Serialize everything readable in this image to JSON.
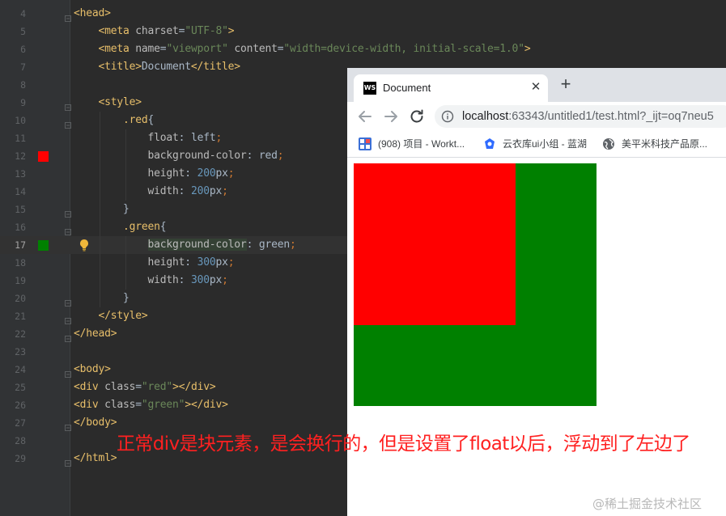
{
  "editor": {
    "lines": [
      {
        "n": "4",
        "parts": [
          [
            "tag",
            "<head>"
          ]
        ]
      },
      {
        "n": "5",
        "parts": [
          [
            "text",
            "    "
          ],
          [
            "tag",
            "<meta "
          ],
          [
            "attr",
            "charset"
          ],
          [
            "text",
            "="
          ],
          [
            "str",
            "\"UTF-8\""
          ],
          [
            "tag",
            ">"
          ]
        ]
      },
      {
        "n": "6",
        "parts": [
          [
            "text",
            "    "
          ],
          [
            "tag",
            "<meta "
          ],
          [
            "attr",
            "name"
          ],
          [
            "text",
            "="
          ],
          [
            "str",
            "\"viewport\" "
          ],
          [
            "attr",
            "content"
          ],
          [
            "text",
            "="
          ],
          [
            "str",
            "\"width=device-width, initial-scale=1.0\""
          ],
          [
            "tag",
            ">"
          ]
        ]
      },
      {
        "n": "7",
        "parts": [
          [
            "text",
            "    "
          ],
          [
            "tag",
            "<title>"
          ],
          [
            "text",
            "Document"
          ],
          [
            "tag",
            "</title>"
          ]
        ]
      },
      {
        "n": "8",
        "parts": []
      },
      {
        "n": "9",
        "parts": [
          [
            "text",
            "    "
          ],
          [
            "tag",
            "<style>"
          ]
        ]
      },
      {
        "n": "10",
        "parts": [
          [
            "text",
            "        "
          ],
          [
            "sel",
            ".red"
          ],
          [
            "text",
            "{"
          ]
        ]
      },
      {
        "n": "11",
        "parts": [
          [
            "text",
            "            "
          ],
          [
            "prop",
            "float"
          ],
          [
            "text",
            ": "
          ],
          [
            "val",
            "left"
          ],
          [
            "punc",
            ";"
          ]
        ]
      },
      {
        "n": "12",
        "parts": [
          [
            "text",
            "            "
          ],
          [
            "prop",
            "background-color"
          ],
          [
            "text",
            ": "
          ],
          [
            "val",
            "red"
          ],
          [
            "punc",
            ";"
          ]
        ]
      },
      {
        "n": "13",
        "parts": [
          [
            "text",
            "            "
          ],
          [
            "prop",
            "height"
          ],
          [
            "text",
            ": "
          ],
          [
            "num",
            "200"
          ],
          [
            "val",
            "px"
          ],
          [
            "punc",
            ";"
          ]
        ]
      },
      {
        "n": "14",
        "parts": [
          [
            "text",
            "            "
          ],
          [
            "prop",
            "width"
          ],
          [
            "text",
            ": "
          ],
          [
            "num",
            "200"
          ],
          [
            "val",
            "px"
          ],
          [
            "punc",
            ";"
          ]
        ]
      },
      {
        "n": "15",
        "parts": [
          [
            "text",
            "        }"
          ]
        ]
      },
      {
        "n": "16",
        "parts": [
          [
            "text",
            "        "
          ],
          [
            "sel",
            ".green"
          ],
          [
            "text",
            "{"
          ]
        ]
      },
      {
        "n": "17",
        "parts": [
          [
            "text",
            "            "
          ],
          [
            "prop",
            "background-color"
          ],
          [
            "text",
            ": "
          ],
          [
            "val",
            "green"
          ],
          [
            "punc",
            ";"
          ]
        ]
      },
      {
        "n": "18",
        "parts": [
          [
            "text",
            "            "
          ],
          [
            "prop",
            "height"
          ],
          [
            "text",
            ": "
          ],
          [
            "num",
            "300"
          ],
          [
            "val",
            "px"
          ],
          [
            "punc",
            ";"
          ]
        ]
      },
      {
        "n": "19",
        "parts": [
          [
            "text",
            "            "
          ],
          [
            "prop",
            "width"
          ],
          [
            "text",
            ": "
          ],
          [
            "num",
            "300"
          ],
          [
            "val",
            "px"
          ],
          [
            "punc",
            ";"
          ]
        ]
      },
      {
        "n": "20",
        "parts": [
          [
            "text",
            "        }"
          ]
        ]
      },
      {
        "n": "21",
        "parts": [
          [
            "text",
            "    "
          ],
          [
            "tag",
            "</style>"
          ]
        ]
      },
      {
        "n": "22",
        "parts": [
          [
            "tag",
            "</head>"
          ]
        ]
      },
      {
        "n": "23",
        "parts": []
      },
      {
        "n": "24",
        "parts": [
          [
            "tag",
            "<body>"
          ]
        ]
      },
      {
        "n": "25",
        "parts": [
          [
            "tag",
            "<div "
          ],
          [
            "attr",
            "class"
          ],
          [
            "text",
            "="
          ],
          [
            "str",
            "\"red\""
          ],
          [
            "tag",
            "></div>"
          ]
        ]
      },
      {
        "n": "26",
        "parts": [
          [
            "tag",
            "<div "
          ],
          [
            "attr",
            "class"
          ],
          [
            "text",
            "="
          ],
          [
            "str",
            "\"green\""
          ],
          [
            "tag",
            "></div>"
          ]
        ]
      },
      {
        "n": "27",
        "parts": [
          [
            "tag",
            "</body>"
          ]
        ]
      },
      {
        "n": "28",
        "parts": []
      },
      {
        "n": "29",
        "parts": [
          [
            "tag",
            "</html>"
          ]
        ]
      }
    ],
    "current_line": "17",
    "color_swatches": {
      "12": "#ff0000",
      "17": "#008000"
    },
    "intention_bulb_line": "17",
    "fold_marker_lines": [
      "4",
      "9",
      "10",
      "15",
      "16",
      "20",
      "21",
      "22",
      "24",
      "27",
      "29"
    ],
    "icons": [
      "color-swatch-icon",
      "lightbulb-icon",
      "fold-marker-icon"
    ]
  },
  "browser": {
    "tab": {
      "title": "Document",
      "favicon_text": "WS",
      "close_glyph": "✕"
    },
    "new_tab_glyph": "+",
    "address": {
      "host": "localhost",
      "path": ":63343/untitled1/test.html?_ijt=oq7neu5"
    },
    "bookmarks": [
      {
        "label": "(908) 项目 - Workt...",
        "icon": "worktile-icon"
      },
      {
        "label": "云衣库ui小组 - 蓝湖",
        "icon": "lanhu-icon"
      },
      {
        "label": "美平米科技产品原...",
        "icon": "globe-icon"
      }
    ],
    "page": {
      "red_box_color": "#ff0000",
      "green_box_color": "#008000"
    }
  },
  "annotation": "正常div是块元素，是会换行的，但是设置了float以后，浮动到了左边了",
  "watermark": "@稀土掘金技术社区"
}
